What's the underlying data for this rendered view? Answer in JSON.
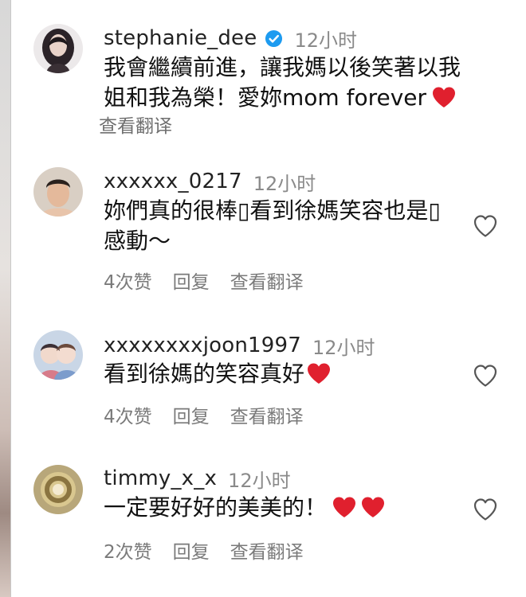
{
  "comments": [
    {
      "username": "stephanie_dee",
      "verified": true,
      "time": "12小时",
      "text": "我會繼續前進，讓我媽以後笑著以我姐和我為榮！愛妳mom forever",
      "hearts": 1,
      "translate_label": "查看翻译",
      "avatar_icon": "woman-portrait-avatar"
    },
    {
      "username": "xxxxxx_0217",
      "time": "12小时",
      "text": "妳們真的很棒▯看到徐媽笑容也是▯感動～",
      "likes_label": "4次赞",
      "reply_label": "回复",
      "translate_label": "查看翻译",
      "avatar_icon": "man-portrait-avatar"
    },
    {
      "username": "xxxxxxxxjoon1997",
      "time": "12小时",
      "text": "看到徐媽的笑容真好",
      "hearts": 1,
      "likes_label": "4次赞",
      "reply_label": "回复",
      "translate_label": "查看翻译",
      "avatar_icon": "cartoon-couple-avatar"
    },
    {
      "username": "timmy_x_x",
      "time": "12小时",
      "text": "一定要好好的美美的！",
      "hearts": 2,
      "likes_label": "2次赞",
      "reply_label": "回复",
      "translate_label": "查看翻译",
      "avatar_icon": "gold-ring-avatar"
    }
  ],
  "colors": {
    "heart": "#e0202e",
    "verified": "#1d9bf0",
    "meta": "#8a8a8a"
  }
}
